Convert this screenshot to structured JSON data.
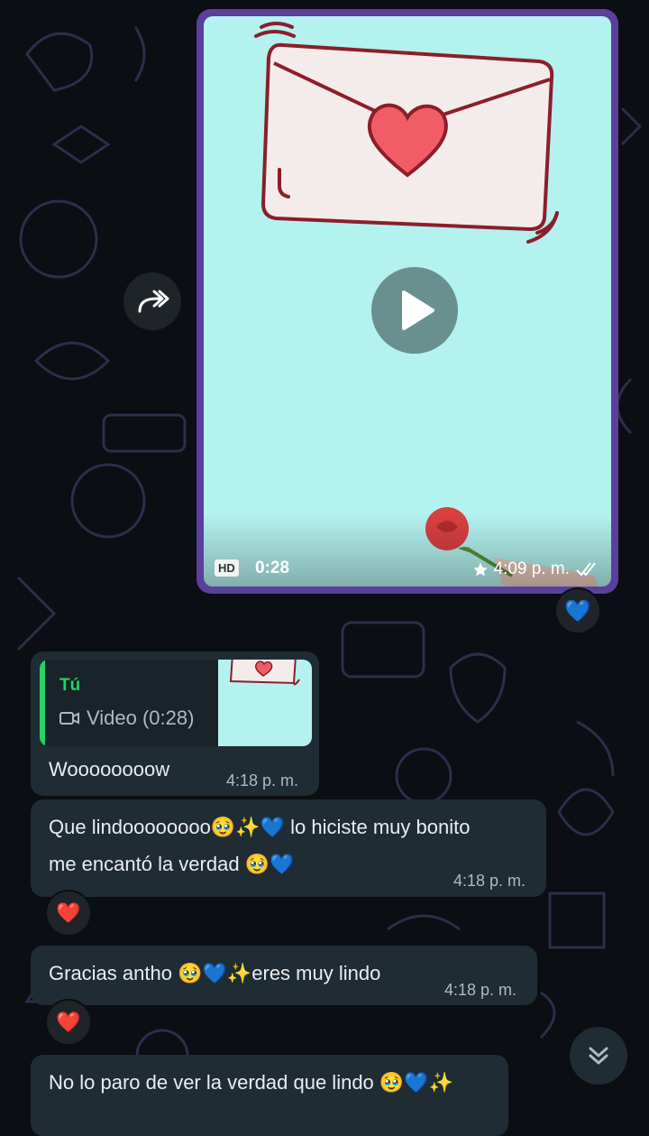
{
  "sent_video": {
    "hd_badge": "HD",
    "duration": "0:28",
    "time": "4:09 p. m.",
    "reaction": "💙"
  },
  "messages": [
    {
      "quote_author": "Tú",
      "quote_text": "Video (0:28)",
      "text": "Woooooooow",
      "time": "4:18 p. m."
    },
    {
      "line1": "Que lindoooooooo🥹✨💙 lo hiciste muy bonito",
      "line2": "me encantó la verdad 🥹💙",
      "time": "4:18 p. m.",
      "reaction": "❤️"
    },
    {
      "text": "Gracias antho 🥹💙✨eres muy lindo",
      "time": "4:18 p. m.",
      "reaction": "❤️"
    },
    {
      "text": "No lo paro de ver la verdad que lindo 🥹💙✨"
    }
  ],
  "icons": {
    "forward": "forward-icon",
    "play": "play-icon",
    "star": "star-icon",
    "read_receipt": "double-check-icon",
    "video": "video-camera-icon",
    "scroll_down": "double-chevron-down-icon"
  },
  "colors": {
    "chat_bg": "#0b0e12",
    "incoming_bubble": "#202c33",
    "accent_green": "#25d366",
    "video_border": "#5a3f9e",
    "video_bg": "#b3f2ef"
  }
}
